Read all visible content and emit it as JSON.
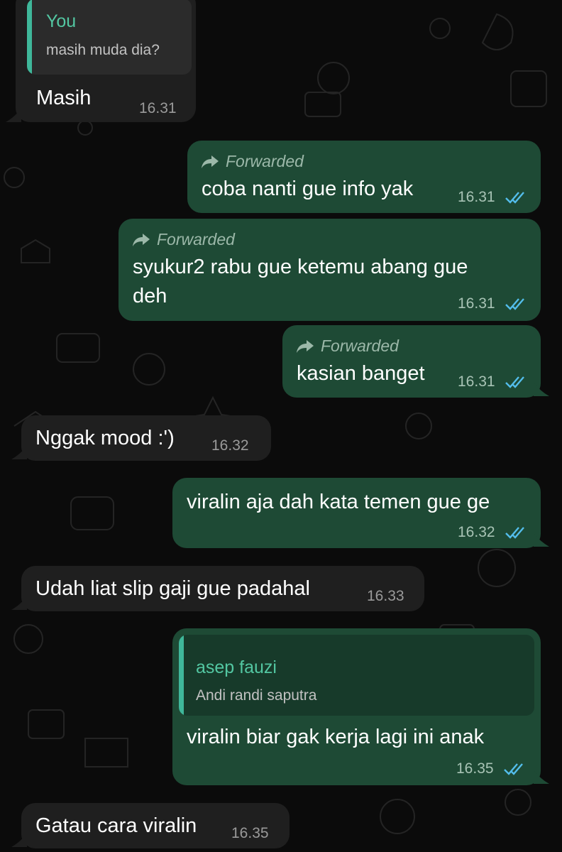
{
  "colors": {
    "background": "#0b0b0b",
    "incoming_bubble": "#1f1f1f",
    "outgoing_bubble": "#1e4a35",
    "quote_name": "#53c7a2",
    "read_ticks": "#53bdeb"
  },
  "messages": [
    {
      "direction": "in",
      "quote_author": "You",
      "quote_text": "masih muda dia?",
      "text": "Masih",
      "time": "16.31"
    },
    {
      "direction": "out",
      "forwarded_label": "Forwarded",
      "text": "coba nanti gue info yak",
      "time": "16.31",
      "status_icon": "double-check-icon"
    },
    {
      "direction": "out",
      "forwarded_label": "Forwarded",
      "text_line1": "syukur2 rabu gue ketemu abang gue",
      "text_line2": "deh",
      "time": "16.31",
      "status_icon": "double-check-icon"
    },
    {
      "direction": "out",
      "forwarded_label": "Forwarded",
      "text": "kasian banget",
      "time": "16.31",
      "status_icon": "double-check-icon"
    },
    {
      "direction": "in",
      "text": "Nggak mood :')",
      "time": "16.32"
    },
    {
      "direction": "out",
      "text": "viralin aja dah kata temen gue ge",
      "time": "16.32",
      "status_icon": "double-check-icon"
    },
    {
      "direction": "in",
      "text": "Udah liat slip gaji gue padahal",
      "time": "16.33"
    },
    {
      "direction": "out",
      "quote_author": "asep fauzi",
      "quote_text": "Andi randi saputra",
      "text": "viralin biar gak kerja lagi ini anak",
      "time": "16.35",
      "status_icon": "double-check-icon"
    },
    {
      "direction": "in",
      "text": "Gatau cara viralin",
      "time": "16.35"
    }
  ]
}
